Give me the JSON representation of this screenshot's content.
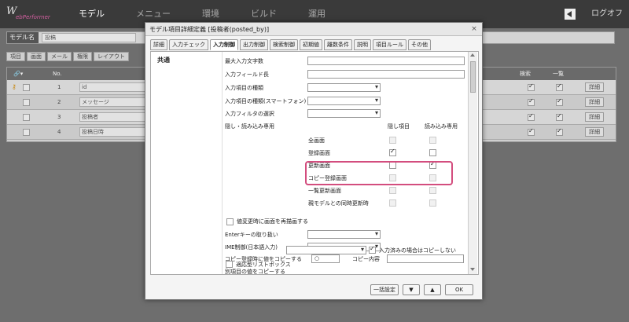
{
  "topnav": {
    "logo_text": "WebPerformer",
    "items": [
      "モデル",
      "メニュー",
      "環境",
      "ビルド",
      "運用"
    ],
    "logout": "ログオフ"
  },
  "bg": {
    "model_label": "モデル名",
    "model_value": "投稿",
    "tabs": [
      "項目",
      "画面",
      "メール",
      "権限",
      "レイアウト"
    ],
    "grid_headers": {
      "no": "No.",
      "search": "検索",
      "list": "一覧"
    },
    "rows": [
      {
        "no": "1",
        "name": "id",
        "search": true,
        "list": true
      },
      {
        "no": "2",
        "name": "メッセージ",
        "search": true,
        "list": true
      },
      {
        "no": "3",
        "name": "投稿者",
        "search": true,
        "list": true
      },
      {
        "no": "4",
        "name": "投稿日時",
        "search": true,
        "list": true
      }
    ],
    "detail_label": "詳細"
  },
  "modal": {
    "title": "モデル項目詳細定義 [投稿者(posted_by)]",
    "close": "×",
    "tabs": [
      "詳細",
      "入力チェック",
      "入力制御",
      "出力制御",
      "検索制御",
      "初期値",
      "離数条件",
      "説明",
      "項目ルール",
      "その他"
    ],
    "active_tab": "入力制御",
    "section": "共通",
    "fields": {
      "max_chars": "最大入力文字数",
      "field_length": "入力フィールド長",
      "input_type": "入力項目の種類",
      "input_type_sp": "入力項目の種類(スマートフォン)",
      "filter": "入力フィルタの選択",
      "hide_readonly": "隠し・読み込み専用"
    },
    "col_hidden": "隠し項目",
    "col_readonly": "読み込み専用",
    "screens": [
      {
        "label": "全画面",
        "hidden": false,
        "readonly": false,
        "disabled": true
      },
      {
        "label": "登録画面",
        "hidden": true,
        "readonly": false,
        "disabled": false
      },
      {
        "label": "更新画面",
        "hidden": false,
        "readonly": true,
        "disabled": false
      },
      {
        "label": "コピー登録画面",
        "hidden": false,
        "readonly": false,
        "disabled": true
      },
      {
        "label": "一覧更新画面",
        "hidden": false,
        "readonly": false,
        "disabled": true
      },
      {
        "label": "親モデルとの同時更新時",
        "hidden": false,
        "readonly": false,
        "disabled": true
      }
    ],
    "redraw_label": "値変更時に画面を再描画する",
    "enter_key": "Enterキーの取り扱い",
    "ime": "IME制御(日本語入力)",
    "copy_value": "コピー登録時に値をコピーする",
    "copy_value_input": "○",
    "copy_content": "コピー内容",
    "copy_other": "別項目の値をコピーする",
    "no_copy_if_entered": "入力済みの場合はコピーしない",
    "adaptive_list": "適応型リストボックス",
    "buttons": {
      "bulk": "一括設定",
      "down": "▼",
      "up": "▲",
      "ok": "OK"
    }
  }
}
